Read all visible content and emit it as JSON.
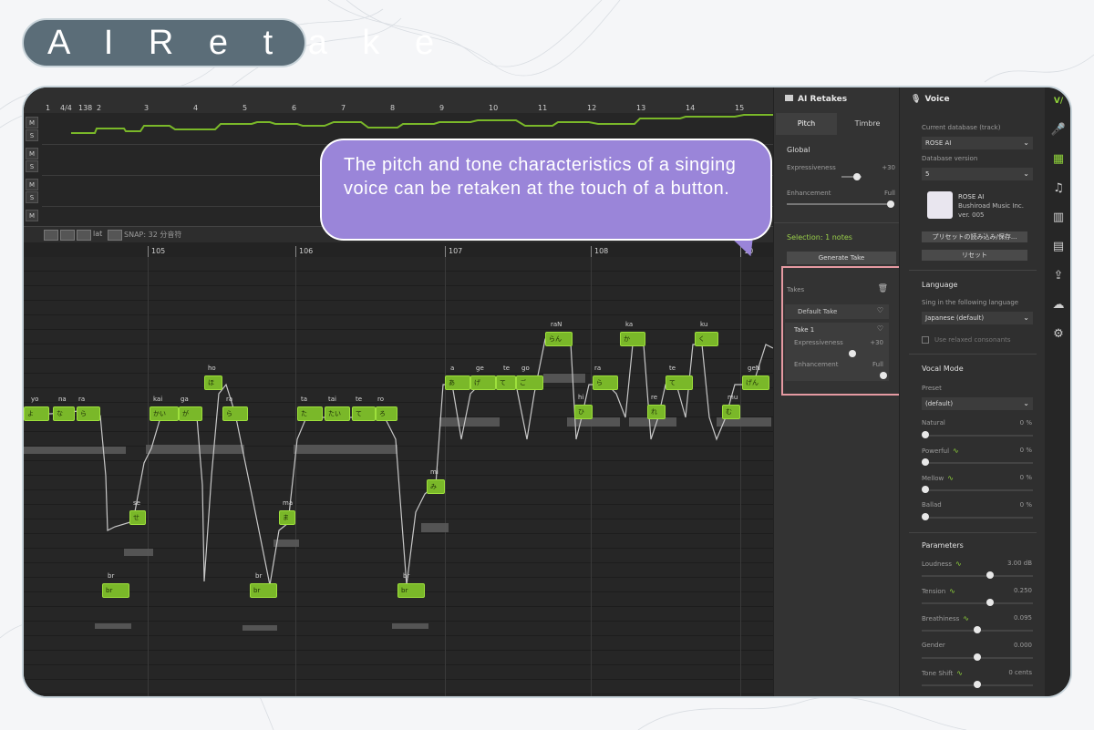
{
  "title": "A I   R e t a k e",
  "callout": "The pitch and tone characteristics of a singing voice can be retaken at the touch of a button.",
  "track_ruler": [
    "1",
    "4/4",
    "138",
    "2",
    "3",
    "4",
    "5",
    "6",
    "7",
    "8",
    "9",
    "10",
    "11",
    "12",
    "13",
    "14",
    "15"
  ],
  "track_controls": [
    "M",
    "S",
    "M",
    "S",
    "M",
    "S",
    "M"
  ],
  "toolbar": {
    "snap_label": "SNAP:",
    "snap_value": "32 分音符",
    "lat_label": "lat"
  },
  "roll_ruler": [
    "105",
    "106",
    "107",
    "108",
    "10"
  ],
  "notes": [
    {
      "text": "よ",
      "lyric": "yo"
    },
    {
      "text": "な",
      "lyric": "na"
    },
    {
      "text": "ら",
      "lyric": "ra"
    },
    {
      "text": "せ",
      "lyric": "se"
    },
    {
      "text": "かい",
      "lyric": "kai"
    },
    {
      "text": "が",
      "lyric": "ga"
    },
    {
      "text": "ほ",
      "lyric": "ho"
    },
    {
      "text": "ら",
      "lyric": "ra"
    },
    {
      "text": "ま",
      "lyric": "ma"
    },
    {
      "text": "た",
      "lyric": "ta"
    },
    {
      "text": "たい",
      "lyric": "tai"
    },
    {
      "text": "て",
      "lyric": "te"
    },
    {
      "text": "ろ",
      "lyric": "ro"
    },
    {
      "text": "み",
      "lyric": "mi"
    },
    {
      "text": "あ",
      "lyric": "a"
    },
    {
      "text": "げ",
      "lyric": "ge"
    },
    {
      "text": "て",
      "lyric": "te"
    },
    {
      "text": "ご",
      "lyric": "go"
    },
    {
      "text": "らん",
      "lyric": "raN"
    },
    {
      "text": "ひ",
      "lyric": "hi"
    },
    {
      "text": "ら",
      "lyric": "ra"
    },
    {
      "text": "か",
      "lyric": "ka"
    },
    {
      "text": "れ",
      "lyric": "re"
    },
    {
      "text": "て",
      "lyric": "te"
    },
    {
      "text": "く",
      "lyric": "ku"
    },
    {
      "text": "む",
      "lyric": "mu"
    },
    {
      "text": "げん",
      "lyric": "geN"
    },
    {
      "text": "br",
      "lyric": "br"
    },
    {
      "text": "br",
      "lyric": "br"
    },
    {
      "text": "br",
      "lyric": "br"
    }
  ],
  "retakes": {
    "header": "AI Retakes",
    "tabs": [
      "Pitch",
      "Timbre"
    ],
    "global_label": "Global",
    "expressiveness_label": "Expressiveness",
    "expressiveness_value": "+30",
    "expressiveness_level": 0.6,
    "enhancement_label": "Enhancement",
    "enhancement_value": "Full",
    "enhancement_level": 1.0,
    "selection": "Selection: 1 notes",
    "generate_button": "Generate Take",
    "takes_label": "Takes",
    "default_take": "Default Take",
    "take1": {
      "label": "Take 1",
      "expressiveness_label": "Expressiveness",
      "expressiveness_value": "+30",
      "enhancement_label": "Enhancement",
      "enhancement_value": "Full"
    }
  },
  "voice": {
    "header": "Voice",
    "current_db_label": "Current database (track)",
    "current_db": "ROSE AI",
    "db_version_label": "Database version",
    "db_version": "5",
    "voice_name": "ROSE AI",
    "publisher": "Bushiroad Music Inc.",
    "version": "ver. 005",
    "preset_button": "プリセットの読み込み/保存...",
    "reset_button": "リセット",
    "language_section": "Language",
    "sing_language_label": "Sing in the following language",
    "language_value": "Japanese (default)",
    "relaxed_label": "Use relaxed consonants",
    "vocal_mode_section": "Vocal Mode",
    "preset_label": "Preset",
    "preset_value": "(default)",
    "modes": [
      {
        "label": "Natural",
        "value": "0 %",
        "wave": false,
        "level": 0.0
      },
      {
        "label": "Powerful",
        "value": "0 %",
        "wave": true,
        "level": 0.0
      },
      {
        "label": "Mellow",
        "value": "0 %",
        "wave": true,
        "level": 0.0
      },
      {
        "label": "Ballad",
        "value": "0 %",
        "wave": false,
        "level": 0.0
      }
    ],
    "parameters_section": "Parameters",
    "params": [
      {
        "label": "Loudness",
        "value": "3.00 dB",
        "wave": true,
        "level": 0.62
      },
      {
        "label": "Tension",
        "value": "0.250",
        "wave": true,
        "level": 0.62
      },
      {
        "label": "Breathiness",
        "value": "0.095",
        "wave": true,
        "level": 0.5
      },
      {
        "label": "Gender",
        "value": "0.000",
        "wave": false,
        "level": 0.5
      },
      {
        "label": "Tone Shift",
        "value": "0 cents",
        "wave": true,
        "level": 0.5
      }
    ]
  },
  "rail_icons": [
    "microphone-icon",
    "clapperboard-icon",
    "music-note-icon",
    "library-icon",
    "book-icon",
    "export-icon",
    "cloud-icon",
    "gear-icon"
  ],
  "colors": {
    "accent": "#8fd33a",
    "callout": "#9a85d9",
    "title_pill": "#5b6d78",
    "highlight_box": "#e59aa2"
  }
}
